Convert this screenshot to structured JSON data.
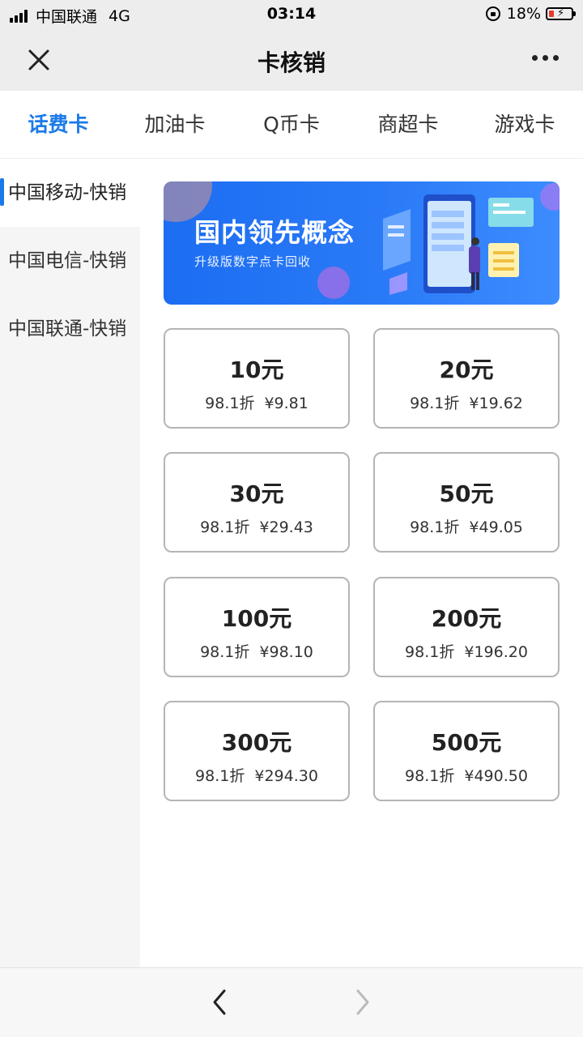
{
  "status_bar": {
    "carrier": "中国联通",
    "network": "4G",
    "time": "03:14",
    "battery": "18%"
  },
  "nav": {
    "title": "卡核销",
    "close_icon": "close-icon",
    "more_icon": "more-icon"
  },
  "tabs": [
    {
      "label": "话费卡",
      "active": true
    },
    {
      "label": "加油卡",
      "active": false
    },
    {
      "label": "Q币卡",
      "active": false
    },
    {
      "label": "商超卡",
      "active": false
    },
    {
      "label": "游戏卡",
      "active": false
    }
  ],
  "sidebar": {
    "items": [
      {
        "label": "中国移动-快销",
        "active": true
      },
      {
        "label": "中国电信-快销",
        "active": false
      },
      {
        "label": "中国联通-快销",
        "active": false
      }
    ]
  },
  "banner": {
    "title": "国内领先概念",
    "subtitle": "升级版数字点卡回收"
  },
  "cards": [
    {
      "amount": "10元",
      "discount": "98.1折",
      "price": "¥9.81"
    },
    {
      "amount": "20元",
      "discount": "98.1折",
      "price": "¥19.62"
    },
    {
      "amount": "30元",
      "discount": "98.1折",
      "price": "¥29.43"
    },
    {
      "amount": "50元",
      "discount": "98.1折",
      "price": "¥49.05"
    },
    {
      "amount": "100元",
      "discount": "98.1折",
      "price": "¥98.10"
    },
    {
      "amount": "200元",
      "discount": "98.1折",
      "price": "¥196.20"
    },
    {
      "amount": "300元",
      "discount": "98.1折",
      "price": "¥294.30"
    },
    {
      "amount": "500元",
      "discount": "98.1折",
      "price": "¥490.50"
    }
  ],
  "colors": {
    "accent": "#1a7ae8",
    "banner": "#2a7af7",
    "battery_low": "#e63b2e"
  },
  "toolbar": {
    "back_icon": "chevron-left-icon",
    "forward_icon": "chevron-right-icon"
  }
}
